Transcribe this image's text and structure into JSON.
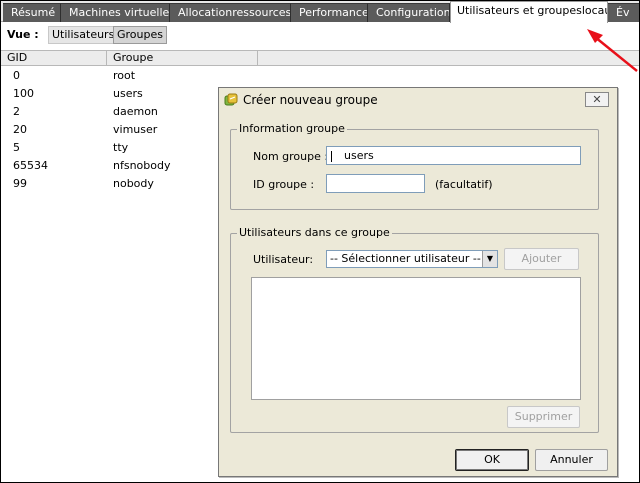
{
  "tabs": [
    {
      "label": "Résumé"
    },
    {
      "label": "Machines virtuelles"
    },
    {
      "label": "Allocationressources"
    },
    {
      "label": "Performance"
    },
    {
      "label": "Configuration"
    },
    {
      "label": "Utilisateurs et groupeslocaux"
    },
    {
      "label": "Év"
    }
  ],
  "view": {
    "label": "Vue :",
    "options": [
      "Utilisateurs",
      "Groupes"
    ],
    "selected": "Groupes"
  },
  "table": {
    "columns": [
      "GID",
      "Groupe"
    ],
    "rows": [
      {
        "gid": "0",
        "group": "root"
      },
      {
        "gid": "100",
        "group": "users"
      },
      {
        "gid": "2",
        "group": "daemon"
      },
      {
        "gid": "20",
        "group": "vimuser"
      },
      {
        "gid": "5",
        "group": "tty"
      },
      {
        "gid": "65534",
        "group": "nfsnobody"
      },
      {
        "gid": "99",
        "group": "nobody"
      }
    ]
  },
  "dialog": {
    "title": "Créer nouveau groupe",
    "close_label": "✕",
    "info_group": {
      "legend": "Information groupe",
      "name_label": "Nom groupe :",
      "name_value": "users",
      "id_label": "ID groupe :",
      "id_value": "",
      "optional_note": "(facultatif)"
    },
    "users_group": {
      "legend": "Utilisateurs dans ce groupe",
      "user_label": "Utilisateur:",
      "user_select": "-- Sélectionner utilisateur --",
      "add_button": "Ajouter",
      "remove_button": "Supprimer"
    },
    "ok_button": "OK",
    "cancel_button": "Annuler"
  },
  "colors": {
    "tab_inactive": "#5b5b5b",
    "tab_active": "#ffffff",
    "dialog_bg": "#ece9d8",
    "annotation_arrow": "#e8101a"
  },
  "icons": {
    "dialog_icon": "group-icon",
    "close": "close-icon",
    "select_arrow": "chevron-down-icon",
    "annotation": "red-arrow-icon"
  }
}
